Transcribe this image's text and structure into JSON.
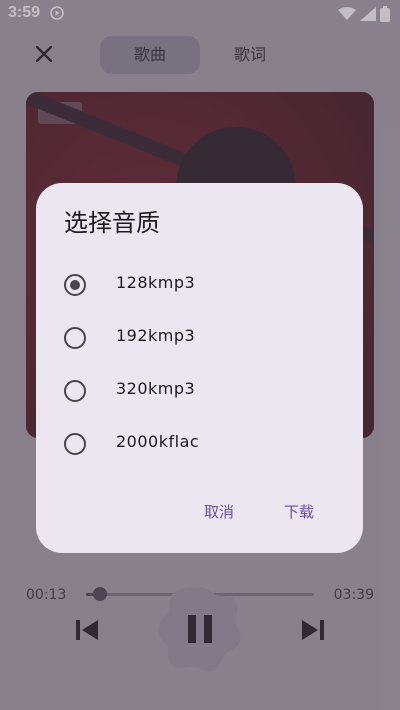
{
  "status_bar": {
    "time": "3:59"
  },
  "tabs": [
    {
      "label": "歌曲"
    },
    {
      "label": "歌词"
    }
  ],
  "dialog": {
    "title": "选择音质",
    "options": [
      {
        "label": "128kmp3",
        "selected": true
      },
      {
        "label": "192kmp3",
        "selected": false
      },
      {
        "label": "320kmp3",
        "selected": false
      },
      {
        "label": "2000kflac",
        "selected": false
      }
    ],
    "cancel_label": "取消",
    "download_label": "下载"
  },
  "player": {
    "current_time": "00:13",
    "total_time": "03:39",
    "progress_fraction": 0.06
  },
  "colors": {
    "accent": "#6750a4",
    "dialog_bg": "#ece6f0"
  },
  "icons": {
    "close": "close-icon",
    "play_status": "play-circle-icon",
    "wifi": "wifi-icon",
    "signal": "signal-icon",
    "battery": "battery-icon",
    "prev": "skip-previous-icon",
    "next": "skip-next-icon",
    "pause": "pause-icon"
  }
}
